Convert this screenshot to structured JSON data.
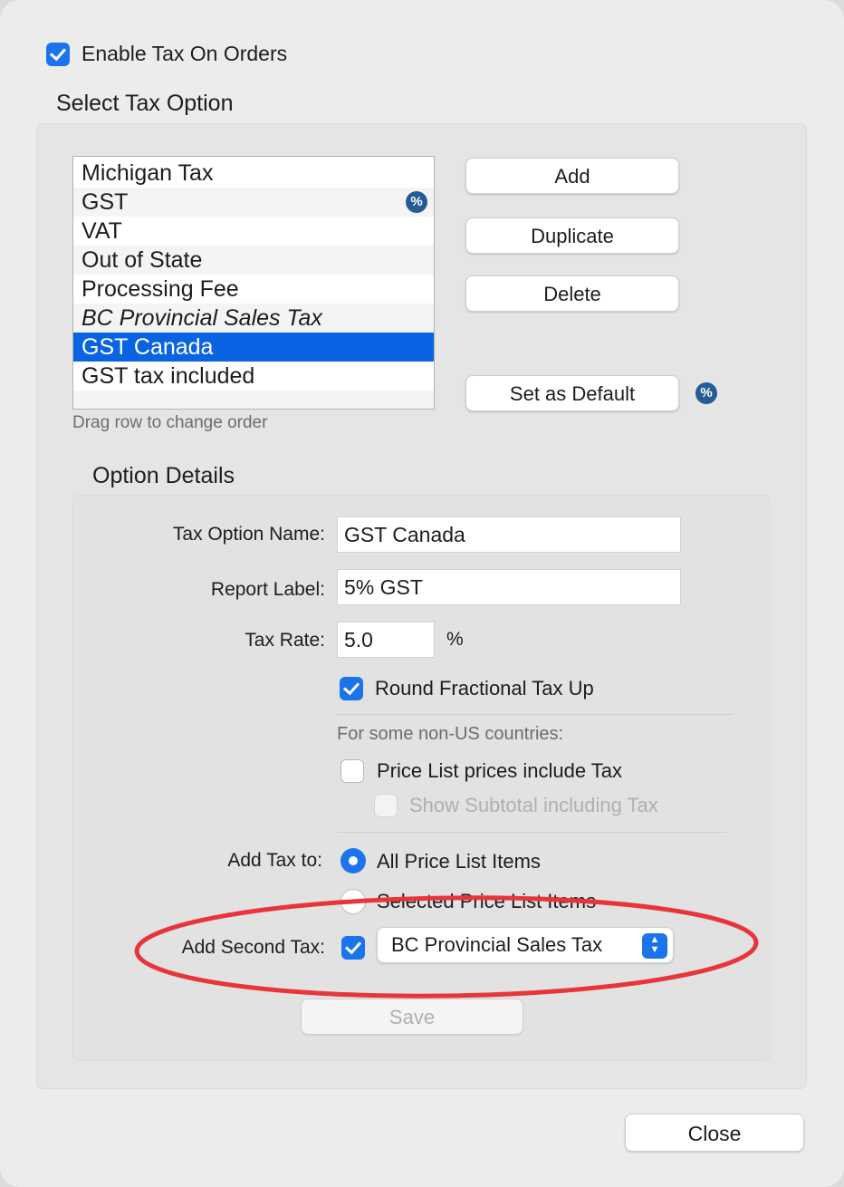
{
  "enable_tax": {
    "label": "Enable Tax On Orders",
    "checked": true
  },
  "select_tax_section": {
    "title": "Select Tax Option"
  },
  "tax_options": [
    {
      "label": "Michigan Tax"
    },
    {
      "label": "GST",
      "is_default": true
    },
    {
      "label": "VAT"
    },
    {
      "label": "Out of State"
    },
    {
      "label": "Processing Fee"
    },
    {
      "label": "BC Provincial Sales Tax",
      "italic": true
    },
    {
      "label": "GST Canada",
      "selected": true
    },
    {
      "label": "GST tax included"
    }
  ],
  "list_hint": "Drag row to change order",
  "list_buttons": {
    "add": "Add",
    "duplicate": "Duplicate",
    "delete": "Delete",
    "set_default": "Set as Default"
  },
  "default_icon_glyph": "%",
  "option_details": {
    "title": "Option Details",
    "tax_option_name_label": "Tax Option Name:",
    "tax_option_name_value": "GST Canada",
    "report_label_label": "Report Label:",
    "report_label_value": "5% GST",
    "tax_rate_label": "Tax Rate:",
    "tax_rate_value": "5.0",
    "tax_rate_unit": "%",
    "round_up_label": "Round Fractional Tax Up",
    "round_up_checked": true,
    "non_us_note": "For some non-US countries:",
    "price_list_include_tax_label": "Price List prices include Tax",
    "price_list_include_tax_checked": false,
    "show_subtotal_label": "Show Subtotal including Tax",
    "show_subtotal_enabled": false,
    "add_tax_to_label": "Add Tax to:",
    "add_tax_to_options": [
      {
        "label": "All Price List Items",
        "selected": true
      },
      {
        "label": "Selected Price List Items",
        "selected": false
      }
    ],
    "add_second_tax_label": "Add Second Tax:",
    "add_second_tax_checked": true,
    "second_tax_selected": "BC Provincial Sales Tax",
    "save_label": "Save",
    "save_enabled": false
  },
  "close_label": "Close",
  "colors": {
    "accent": "#1c74ea",
    "selection": "#0a63e0",
    "annotation": "#e8353b"
  }
}
